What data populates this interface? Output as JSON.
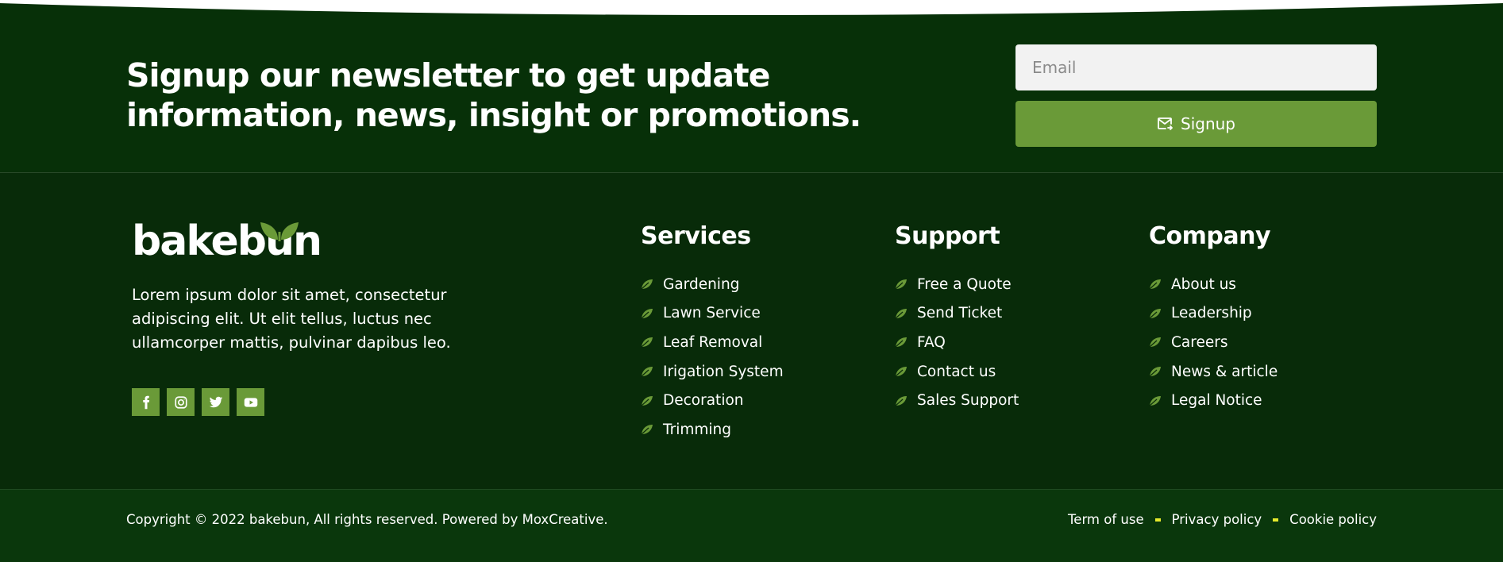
{
  "colors": {
    "background": "#082b09",
    "newsletter_bg": "#073008",
    "bottom_bar_bg": "#0a370c",
    "accent_green": "#6a9a38",
    "separator_yellow": "#e6ea2c",
    "input_bg": "#f2f2f2"
  },
  "newsletter": {
    "title": "Signup our newsletter to get update information, news, insight or promotions.",
    "email_placeholder": "Email",
    "signup_label": "Signup",
    "signup_icon": "mail-send-icon"
  },
  "brand": {
    "logo_text": "bakebun",
    "logo_icon": "leaves-icon",
    "about": "Lorem ipsum dolor sit amet, consectetur adipiscing elit. Ut elit tellus, luctus nec ullamcorper mattis, pulvinar dapibus leo."
  },
  "socials": [
    {
      "icon": "facebook-icon"
    },
    {
      "icon": "instagram-icon"
    },
    {
      "icon": "twitter-icon"
    },
    {
      "icon": "youtube-icon"
    }
  ],
  "columns": {
    "services": {
      "title": "Services",
      "items": [
        "Gardening",
        "Lawn Service",
        "Leaf Removal",
        "Irigation System",
        "Decoration",
        "Trimming"
      ]
    },
    "support": {
      "title": "Support",
      "items": [
        "Free a Quote",
        "Send Ticket",
        "FAQ",
        "Contact us",
        "Sales Support"
      ]
    },
    "company": {
      "title": "Company",
      "items": [
        "About us",
        "Leadership",
        "Careers",
        "News & article",
        "Legal Notice"
      ]
    }
  },
  "bottom": {
    "copyright": "Copyright © 2022 bakebun, All rights reserved. Powered by MoxCreative.",
    "links": [
      "Term of use",
      "Privacy policy",
      "Cookie policy"
    ]
  }
}
